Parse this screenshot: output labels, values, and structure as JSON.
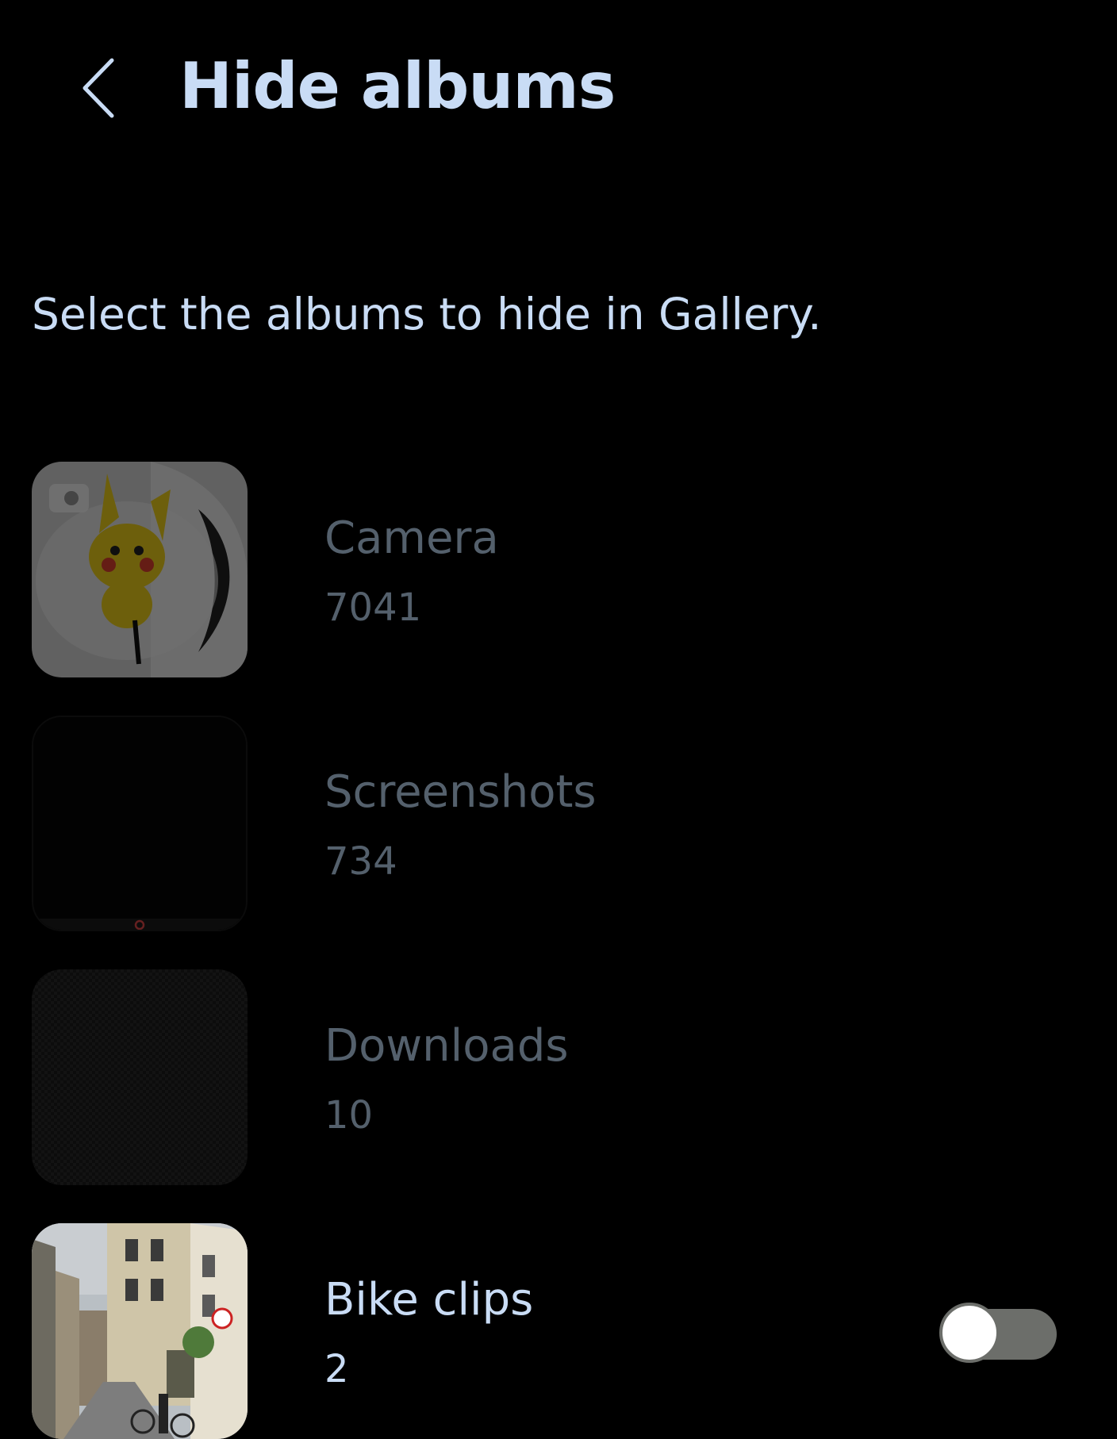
{
  "header": {
    "back_icon": "chevron-left-icon",
    "title": "Hide albums"
  },
  "description": "Select the albums to hide in Gallery.",
  "albums": [
    {
      "name": "Camera",
      "count": "7041",
      "hidden_toggle_visible": false
    },
    {
      "name": "Screenshots",
      "count": "734",
      "hidden_toggle_visible": false
    },
    {
      "name": "Downloads",
      "count": "10",
      "hidden_toggle_visible": false
    },
    {
      "name": "Bike clips",
      "count": "2",
      "hidden_toggle_visible": true,
      "hidden": false
    }
  ],
  "colors": {
    "background": "#000000",
    "primary_text": "#c9dcf5",
    "disabled_text": "#54606c",
    "toggle_off_track": "#6c6e6a",
    "toggle_thumb": "#ffffff"
  }
}
